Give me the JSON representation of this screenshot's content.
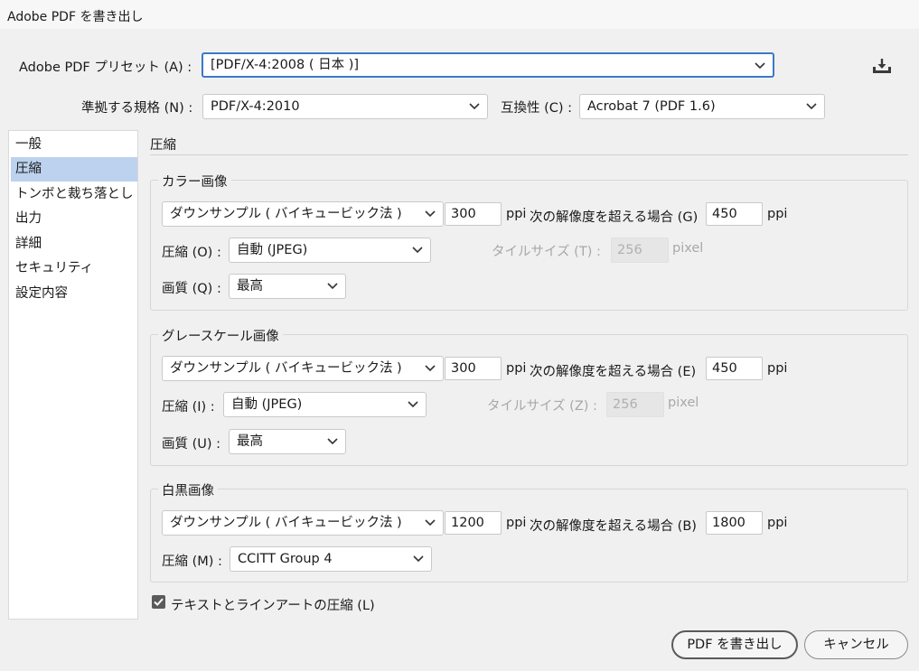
{
  "window": {
    "title": "Adobe PDF を書き出し"
  },
  "top": {
    "preset_label": "Adobe PDF プリセット (A) :",
    "preset_value": "[PDF/X-4:2008 ( 日本 )]",
    "standard_label": "準拠する規格 (N) :",
    "standard_value": "PDF/X-4:2010",
    "compat_label": "互換性 (C) :",
    "compat_value": "Acrobat 7 (PDF 1.6)",
    "save_preset_icon": "download-icon"
  },
  "sidebar": {
    "items": [
      {
        "label": "一般"
      },
      {
        "label": "圧縮"
      },
      {
        "label": "トンボと裁ち落とし"
      },
      {
        "label": "出力"
      },
      {
        "label": "詳細"
      },
      {
        "label": "セキュリティ"
      },
      {
        "label": "設定内容"
      }
    ],
    "selected": "圧縮"
  },
  "main": {
    "section_title": "圧縮",
    "color": {
      "title": "カラー画像",
      "sampling": "ダウンサンプル ( バイキュービック法 )",
      "ppi": "300",
      "ppi_unit": "ppi",
      "above_label": "次の解像度を超える場合 (G)",
      "above_value": "450",
      "above_unit": "ppi",
      "compression_label": "圧縮 (O) :",
      "compression_value": "自動 (JPEG)",
      "tile_label": "タイルサイズ (T) :",
      "tile_value": "256",
      "tile_unit": "pixel",
      "quality_label": "画質 (Q) :",
      "quality_value": "最高"
    },
    "gray": {
      "title": "グレースケール画像",
      "sampling": "ダウンサンプル ( バイキュービック法 )",
      "ppi": "300",
      "ppi_unit": "ppi",
      "above_label": "次の解像度を超える場合 (E)",
      "above_value": "450",
      "above_unit": "ppi",
      "compression_label": "圧縮 (I) :",
      "compression_value": "自動 (JPEG)",
      "tile_label": "タイルサイズ (Z) :",
      "tile_value": "256",
      "tile_unit": "pixel",
      "quality_label": "画質 (U) :",
      "quality_value": "最高"
    },
    "mono": {
      "title": "白黒画像",
      "sampling": "ダウンサンプル ( バイキュービック法 )",
      "ppi": "1200",
      "ppi_unit": "ppi",
      "above_label": "次の解像度を超える場合 (B)",
      "above_value": "1800",
      "above_unit": "ppi",
      "compression_label": "圧縮 (M) :",
      "compression_value": "CCITT Group 4"
    },
    "text_compress_label": "テキストとラインアートの圧縮 (L)",
    "text_compress_checked": true
  },
  "footer": {
    "export_label": "PDF を書き出し",
    "cancel_label": "キャンセル"
  }
}
